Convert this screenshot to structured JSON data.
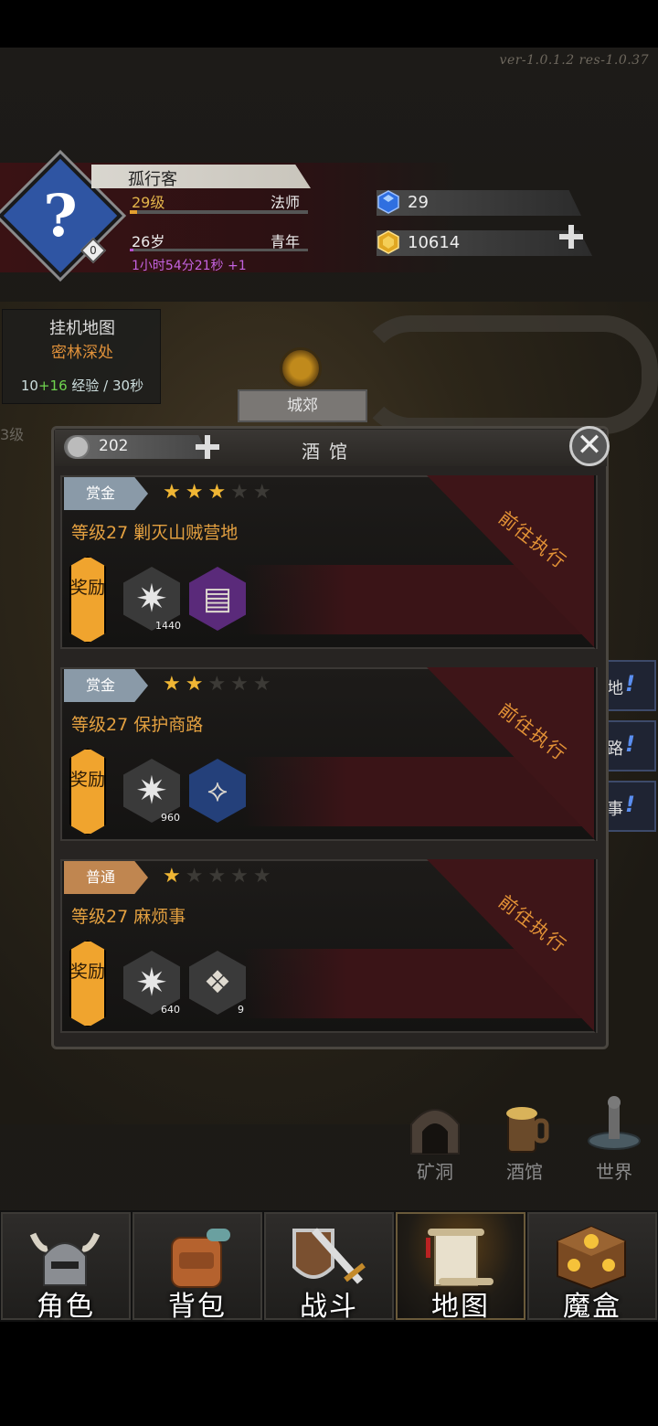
{
  "version": "ver-1.0.1.2   res-1.0.37",
  "character": {
    "avatar_badge": "0",
    "name": "孤行客",
    "level": "29级",
    "class": "法师",
    "age": "26岁",
    "life_stage": "青年",
    "timer": "1小时54分21秒 +1",
    "level_progress": 0.04,
    "age_progress": 0.02
  },
  "resources": {
    "gems": "29",
    "gold": "10614"
  },
  "idle_map": {
    "title": "挂机地图",
    "location": "密林深处",
    "exp_base": "10",
    "exp_bonus": "+16",
    "exp_suffix": " 经验 / 30秒"
  },
  "map": {
    "city_label": "城郊",
    "left_edge_text": "3级"
  },
  "tavern": {
    "title": "酒馆",
    "tickets": "202",
    "quests": [
      {
        "tag": "赏金",
        "stars": 3,
        "title": "等级27 剿灭山贼营地",
        "reward_label": "奖励",
        "exp": "1440",
        "item_count": "",
        "action": "前往执行"
      },
      {
        "tag": "赏金",
        "stars": 2,
        "title": "等级27 保护商路",
        "reward_label": "奖励",
        "exp": "960",
        "item_count": "",
        "action": "前往执行"
      },
      {
        "tag": "普通",
        "stars": 1,
        "title": "等级27 麻烦事",
        "reward_label": "奖励",
        "exp": "640",
        "item_count": "9",
        "action": "前往执行"
      }
    ]
  },
  "side_tabs": [
    "地",
    "路",
    "事"
  ],
  "pois": [
    "矿洞",
    "酒馆",
    "世界"
  ],
  "nav": [
    "角色",
    "背包",
    "战斗",
    "地图",
    "魔盒"
  ],
  "colors": {
    "gold_accent": "#f0b634",
    "quest_title": "#e3a040",
    "bounty_tag": "#8a9aa8",
    "normal_tag": "#c08650",
    "exp_green": "#6fd44f",
    "timer_purple": "#c463e0"
  }
}
